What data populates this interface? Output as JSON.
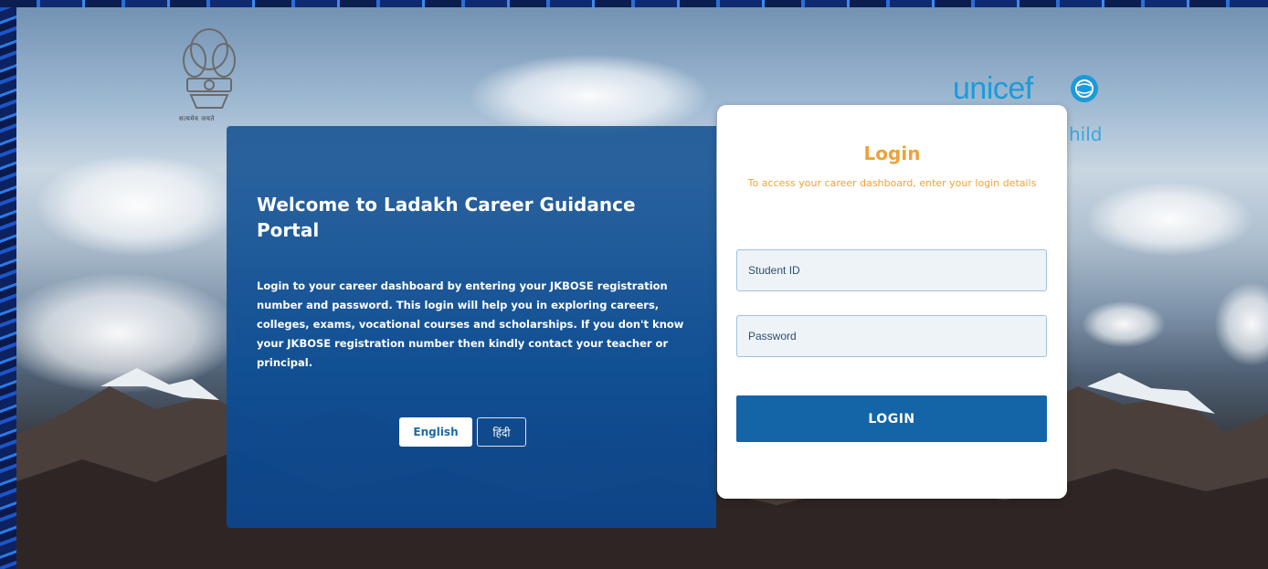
{
  "header": {
    "emblem_caption": "सत्यमेव जयते",
    "partner_logo": "unicef",
    "partner_tagline": "hild"
  },
  "welcome": {
    "title": "Welcome to Ladakh Career Guidance Portal",
    "body": "Login to your career dashboard by entering your JKBOSE registration number and password. This login will help you in exploring careers, colleges, exams, vocational courses and scholarships. If you don't know your JKBOSE registration number then kindly contact your teacher or principal.",
    "languages": [
      {
        "label": "English",
        "active": true
      },
      {
        "label": "हिंदी",
        "active": false
      }
    ]
  },
  "login": {
    "title": "Login",
    "subtitle": "To access your career dashboard, enter your login details",
    "student_id_placeholder": "Student ID",
    "password_placeholder": "Password",
    "button_label": "LOGIN"
  },
  "colors": {
    "accent_orange": "#f0a13a",
    "primary_blue": "#1465a8",
    "unicef_blue": "#1c9bd8"
  },
  "icons": [
    "national-emblem-icon",
    "unicef-globe-icon"
  ]
}
